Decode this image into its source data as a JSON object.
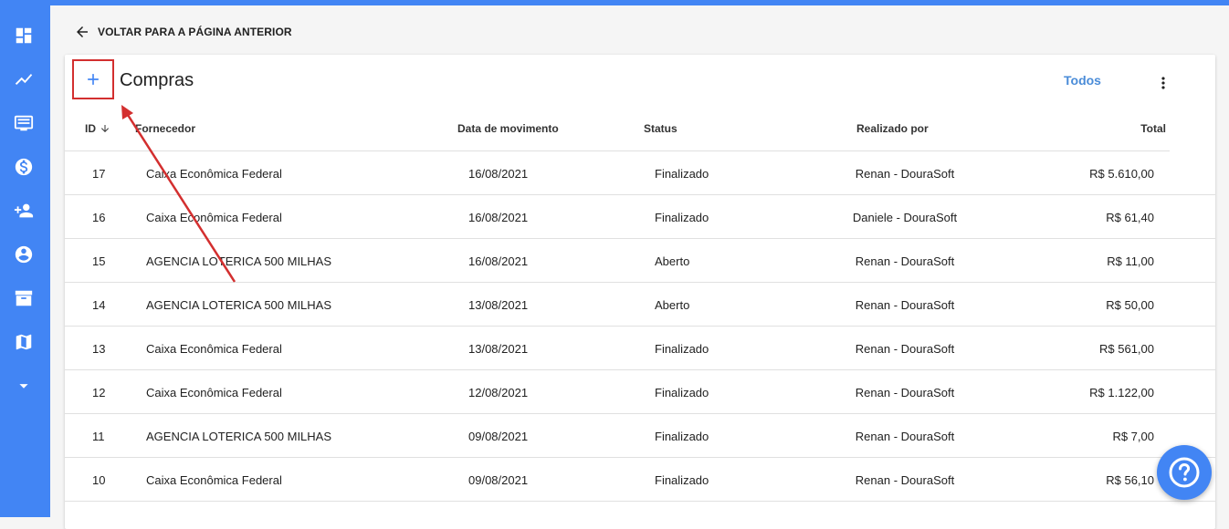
{
  "colors": {
    "accent": "#4285f4",
    "highlight": "#d32f2f",
    "link": "#4a8cd8"
  },
  "sidebar": {
    "icons": [
      "dashboard-icon",
      "trending-icon",
      "monitor-icon",
      "money-icon",
      "person-add-icon",
      "account-icon",
      "archive-icon",
      "map-icon",
      "expand-more-icon"
    ]
  },
  "back_link": {
    "label": "VOLTAR PARA A PÁGINA ANTERIOR"
  },
  "card": {
    "title": "Compras",
    "filter_label": "Todos"
  },
  "table": {
    "headers": {
      "id": "ID",
      "fornecedor": "Fornecedor",
      "data": "Data de movimento",
      "status": "Status",
      "realizado": "Realizado por",
      "total": "Total"
    },
    "rows": [
      {
        "id": "17",
        "fornecedor": "Caixa Econômica Federal",
        "data": "16/08/2021",
        "status": "Finalizado",
        "realizado": "Renan - DouraSoft",
        "total": "R$ 5.610,00"
      },
      {
        "id": "16",
        "fornecedor": "Caixa Econômica Federal",
        "data": "16/08/2021",
        "status": "Finalizado",
        "realizado": "Daniele - DouraSoft",
        "total": "R$ 61,40"
      },
      {
        "id": "15",
        "fornecedor": "AGENCIA LOTERICA 500 MILHAS",
        "data": "16/08/2021",
        "status": "Aberto",
        "realizado": "Renan - DouraSoft",
        "total": "R$ 11,00"
      },
      {
        "id": "14",
        "fornecedor": "AGENCIA LOTERICA 500 MILHAS",
        "data": "13/08/2021",
        "status": "Aberto",
        "realizado": "Renan - DouraSoft",
        "total": "R$ 50,00"
      },
      {
        "id": "13",
        "fornecedor": "Caixa Econômica Federal",
        "data": "13/08/2021",
        "status": "Finalizado",
        "realizado": "Renan - DouraSoft",
        "total": "R$ 561,00"
      },
      {
        "id": "12",
        "fornecedor": "Caixa Econômica Federal",
        "data": "12/08/2021",
        "status": "Finalizado",
        "realizado": "Renan - DouraSoft",
        "total": "R$ 1.122,00"
      },
      {
        "id": "11",
        "fornecedor": "AGENCIA LOTERICA 500 MILHAS",
        "data": "09/08/2021",
        "status": "Finalizado",
        "realizado": "Renan - DouraSoft",
        "total": "R$ 7,00"
      },
      {
        "id": "10",
        "fornecedor": "Caixa Econômica Federal",
        "data": "09/08/2021",
        "status": "Finalizado",
        "realizado": "Renan - DouraSoft",
        "total": "R$ 56,10"
      }
    ]
  }
}
